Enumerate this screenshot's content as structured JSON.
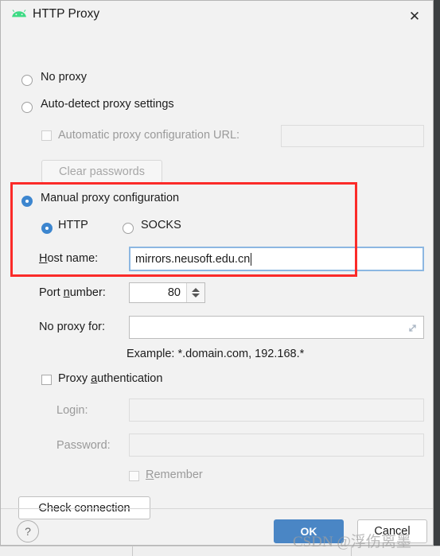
{
  "window": {
    "title": "HTTP Proxy",
    "icon": "android-icon",
    "close_label": "✕"
  },
  "proxy_mode": {
    "options": [
      {
        "id": "no-proxy",
        "label": "No proxy",
        "selected": false
      },
      {
        "id": "auto-detect",
        "label": "Auto-detect proxy settings",
        "selected": false
      },
      {
        "id": "manual",
        "label": "Manual proxy configuration",
        "selected": true
      }
    ]
  },
  "auto_section": {
    "pac_checkbox_label": "Automatic proxy configuration URL:",
    "pac_checked": false,
    "pac_url_value": "",
    "clear_passwords_label": "Clear passwords",
    "disabled": true
  },
  "manual_section": {
    "protocol": {
      "http_label": "HTTP",
      "http_selected": true,
      "socks_label": "SOCKS",
      "socks_selected": false
    },
    "host": {
      "label": "Host name:",
      "mnemonic": "H",
      "value": "mirrors.neusoft.edu.cn",
      "focused": true
    },
    "port": {
      "label": "Port number:",
      "mnemonic": "n",
      "value": "80"
    },
    "no_proxy_for": {
      "label": "No proxy for:",
      "value": "",
      "expand_icon": "expand-diagonal-icon"
    },
    "example_text": "Example: *.domain.com, 192.168.*"
  },
  "authentication": {
    "checkbox_label": "Proxy authentication",
    "mnemonic": "a",
    "checked": false,
    "login": {
      "label": "Login:",
      "value": "",
      "disabled": true
    },
    "password": {
      "label": "Password:",
      "value": "",
      "disabled": true
    },
    "remember": {
      "label": "Remember",
      "mnemonic": "R",
      "checked": false,
      "disabled": true
    }
  },
  "actions": {
    "check_connection_label": "Check connection",
    "help_label": "?",
    "ok_label": "OK",
    "cancel_label": "Cancel"
  },
  "watermark": {
    "text": "CSDN @浮伤离墨"
  },
  "colors": {
    "accent_blue": "#3d86cf",
    "primary_button": "#4a86c5",
    "highlight_red": "#fb2b29",
    "focus_border": "#8cb7e2",
    "android_green": "#3ddb84",
    "dialog_bg": "#f2f2f2"
  }
}
